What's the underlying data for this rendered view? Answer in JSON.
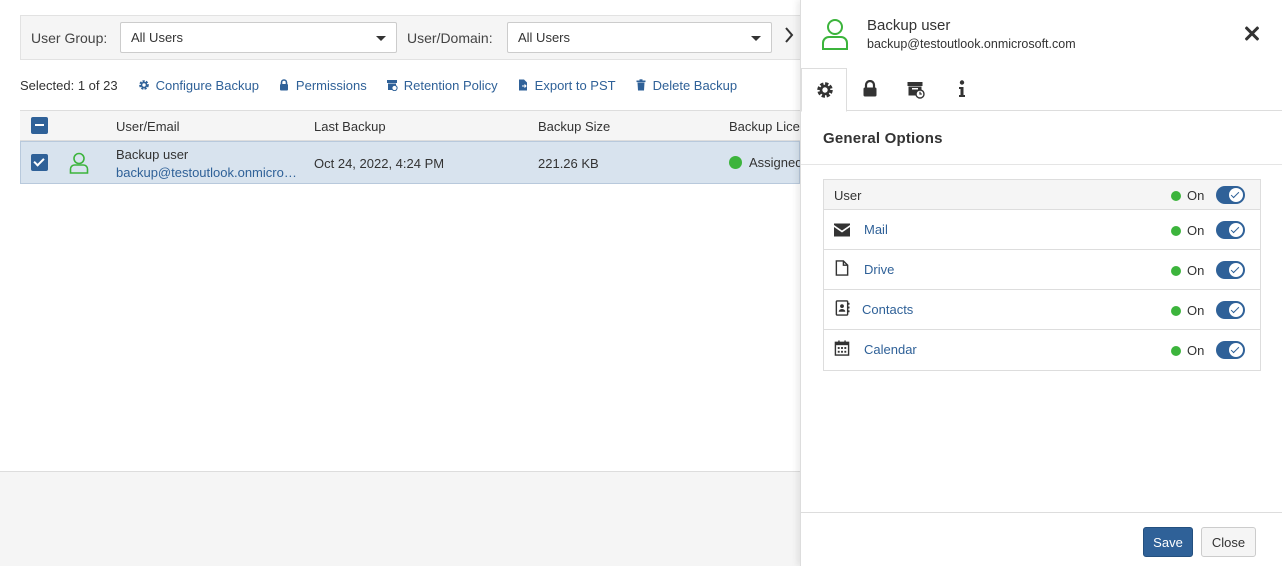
{
  "filters": {
    "user_group_label": "User Group:",
    "user_group_value": "All Users",
    "user_domain_label": "User/Domain:",
    "user_domain_value": "All Users"
  },
  "toolbar": {
    "selected": "Selected: 1 of 23",
    "configure_backup": "Configure Backup",
    "permissions": "Permissions",
    "retention_policy": "Retention Policy",
    "export_pst": "Export to PST",
    "delete_backup": "Delete Backup"
  },
  "table": {
    "columns": [
      "User/Email",
      "Last Backup",
      "Backup Size",
      "Backup Licer"
    ],
    "rows": [
      {
        "name": "Backup user",
        "email": "backup@testoutlook.onmicro…",
        "last_backup": "Oct 24, 2022, 4:24 PM",
        "size": "221.26 KB",
        "license": "Assigned"
      }
    ]
  },
  "panel": {
    "name": "Backup user",
    "email": "backup@testoutlook.onmicrosoft.com",
    "section_title": "General Options",
    "options": [
      {
        "label": "User",
        "status": "On"
      },
      {
        "label": "Mail",
        "status": "On"
      },
      {
        "label": "Drive",
        "status": "On"
      },
      {
        "label": "Contacts",
        "status": "On"
      },
      {
        "label": "Calendar",
        "status": "On"
      }
    ],
    "save_label": "Save",
    "close_label": "Close"
  },
  "colors": {
    "accent": "#2f6198",
    "status_on": "#3cb43c",
    "user_icon": "#3cb43c",
    "row_selected": "#d8e3ee"
  }
}
